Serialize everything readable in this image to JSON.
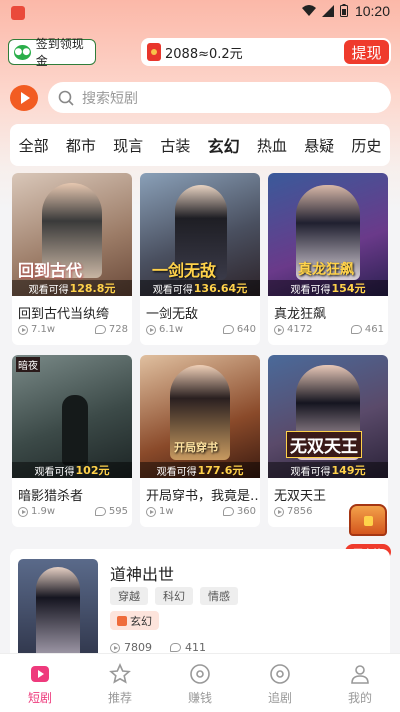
{
  "status_bar": {
    "time": "10:20"
  },
  "header": {
    "checkin_label": "签到领现金",
    "coins_text": "2088≈0.2元",
    "withdraw_label": "提现"
  },
  "search": {
    "placeholder": "搜索短剧"
  },
  "tabs": [
    "全部",
    "都市",
    "现言",
    "古装",
    "玄幻",
    "热血",
    "悬疑",
    "历史"
  ],
  "active_tab": "玄幻",
  "earn_prefix": "观看可得",
  "dramas": [
    {
      "title": "回到古代当纨绔",
      "earn": "128.8元",
      "views": "7.1w",
      "likes": "728"
    },
    {
      "title": "一剑无敌",
      "earn": "136.64元",
      "views": "6.1w",
      "likes": "640"
    },
    {
      "title": "真龙狂飙",
      "earn": "154元",
      "views": "4172",
      "likes": "461"
    },
    {
      "title": "暗影猎杀者",
      "earn": "102元",
      "views": "1.9w",
      "likes": "595"
    },
    {
      "title": "开局穿书，我竟是…",
      "earn": "177.6元",
      "views": "1w",
      "likes": "360"
    },
    {
      "title": "无双天王",
      "earn": "149元",
      "views": "7856",
      "likes": ""
    }
  ],
  "poster_text": [
    "回到古代",
    "一剑无敌",
    "真龙狂飙",
    "暗夜",
    "开局穿书",
    "无双天王"
  ],
  "treasure": {
    "label": "开宝箱"
  },
  "featured": {
    "title": "道神出世",
    "tags": [
      "穿越",
      "科幻",
      "情感"
    ],
    "genre": "玄幻",
    "views": "7809",
    "likes": "411"
  },
  "nav": [
    {
      "label": "短剧",
      "icon": "play-icon"
    },
    {
      "label": "推荐",
      "icon": "star-icon"
    },
    {
      "label": "赚钱",
      "icon": "coin-icon"
    },
    {
      "label": "追剧",
      "icon": "bookmark-icon"
    },
    {
      "label": "我的",
      "icon": "user-icon"
    }
  ],
  "colors": {
    "accent": "#ef3b2c",
    "nav_active": "#ee3a7c",
    "earn_highlight": "#ffd24a"
  }
}
